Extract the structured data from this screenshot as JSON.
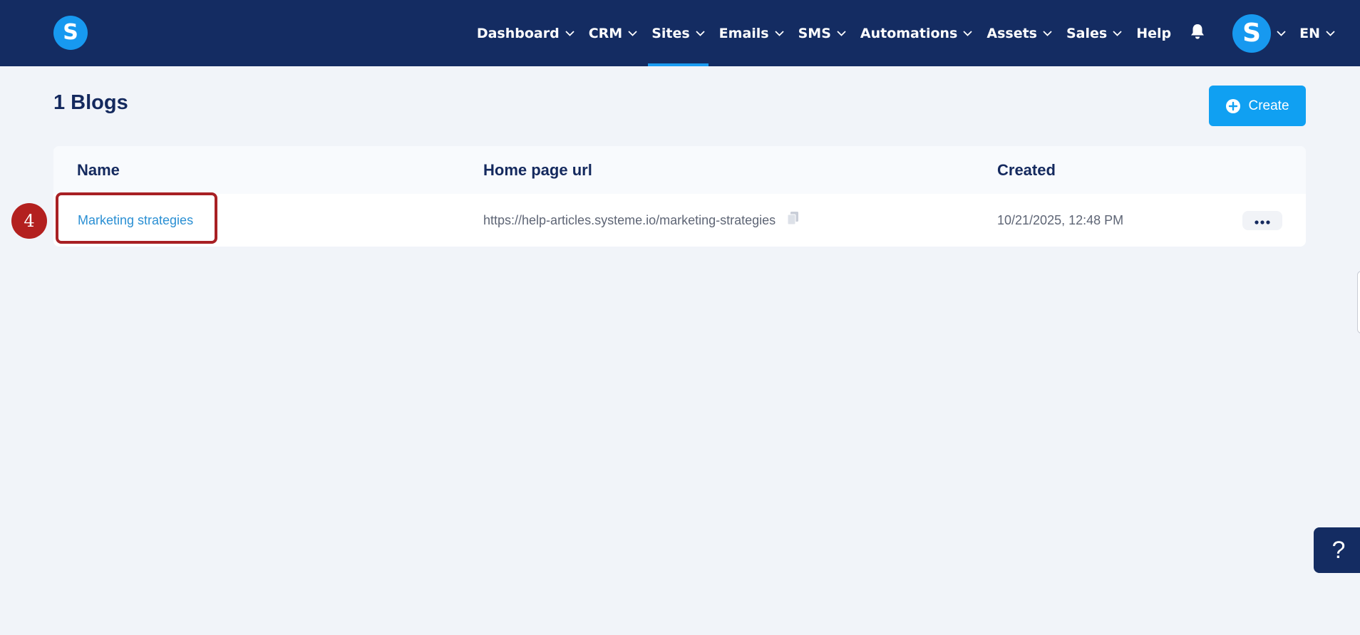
{
  "app": {
    "logo_letter": "S",
    "brand_color": "#1799f0",
    "nav_bg": "#142c62"
  },
  "nav": {
    "items": [
      {
        "label": "Dashboard",
        "dropdown": true
      },
      {
        "label": "CRM",
        "dropdown": true
      },
      {
        "label": "Sites",
        "dropdown": true,
        "active": true
      },
      {
        "label": "Emails",
        "dropdown": true
      },
      {
        "label": "SMS",
        "dropdown": true
      },
      {
        "label": "Automations",
        "dropdown": true
      },
      {
        "label": "Assets",
        "dropdown": true
      },
      {
        "label": "Sales",
        "dropdown": true
      },
      {
        "label": "Help",
        "dropdown": false
      }
    ],
    "avatar_letter": "S",
    "language": "EN"
  },
  "page": {
    "title": "1 Blogs",
    "create_label": "Create"
  },
  "table": {
    "columns": [
      "Name",
      "Home page url",
      "Created"
    ],
    "rows": [
      {
        "name": "Marketing strategies",
        "url": "https://help-articles.systeme.io/marketing-strategies",
        "created": "10/21/2025, 12:48 PM"
      }
    ]
  },
  "annotation": {
    "step_number": "4",
    "color": "#b3201f"
  },
  "help_fab": {
    "label": "?"
  },
  "icons": [
    "chevron-down-icon",
    "bell-icon",
    "plus-circle-icon",
    "copy-icon",
    "more-horizontal-icon"
  ]
}
